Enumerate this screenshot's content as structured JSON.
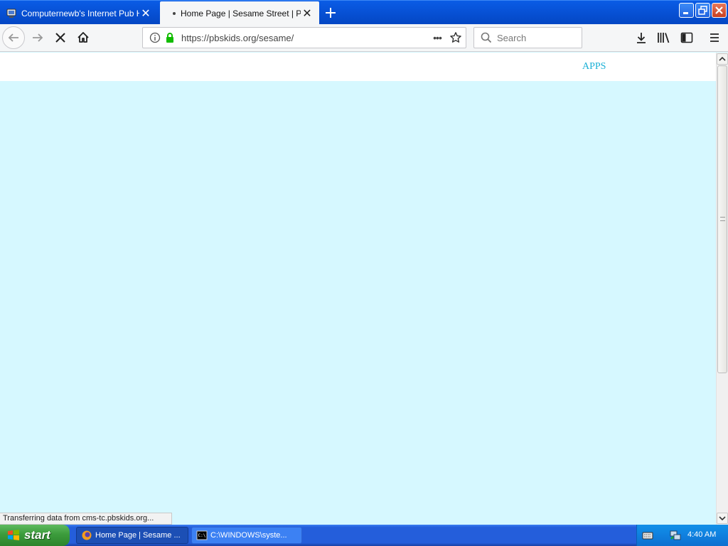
{
  "tabs": [
    {
      "title": "Computernewb's Internet Pub Hub",
      "active": false
    },
    {
      "title": "Home Page | Sesame Street | PBS",
      "active": true
    }
  ],
  "nav": {
    "url": "https://pbskids.org/sesame/",
    "search_placeholder": "Search"
  },
  "page": {
    "header_link": "APPS",
    "background": "#d6f8ff",
    "link_color": "#1ab0d6"
  },
  "status": {
    "text": "Transferring data from cms-tc.pbskids.org..."
  },
  "taskbar": {
    "start_label": "start",
    "tasks": [
      {
        "label": "Home Page | Sesame ...",
        "active": true
      },
      {
        "label": "C:\\WINDOWS\\syste...",
        "active": false
      }
    ],
    "clock": "4:40 AM"
  },
  "icons": {
    "tab1_favicon": "computer-icon",
    "tab_close": "close-icon",
    "new_tab": "plus-icon",
    "back": "back-arrow-icon",
    "forward": "forward-arrow-icon",
    "stop": "stop-icon",
    "home": "home-icon",
    "info": "info-icon",
    "lock": "lock-icon",
    "more": "ellipsis-icon",
    "bookmark": "star-icon",
    "search": "search-icon",
    "downloads": "download-icon",
    "library": "library-icon",
    "sidebar": "sidebar-icon",
    "menu": "hamburger-icon"
  }
}
